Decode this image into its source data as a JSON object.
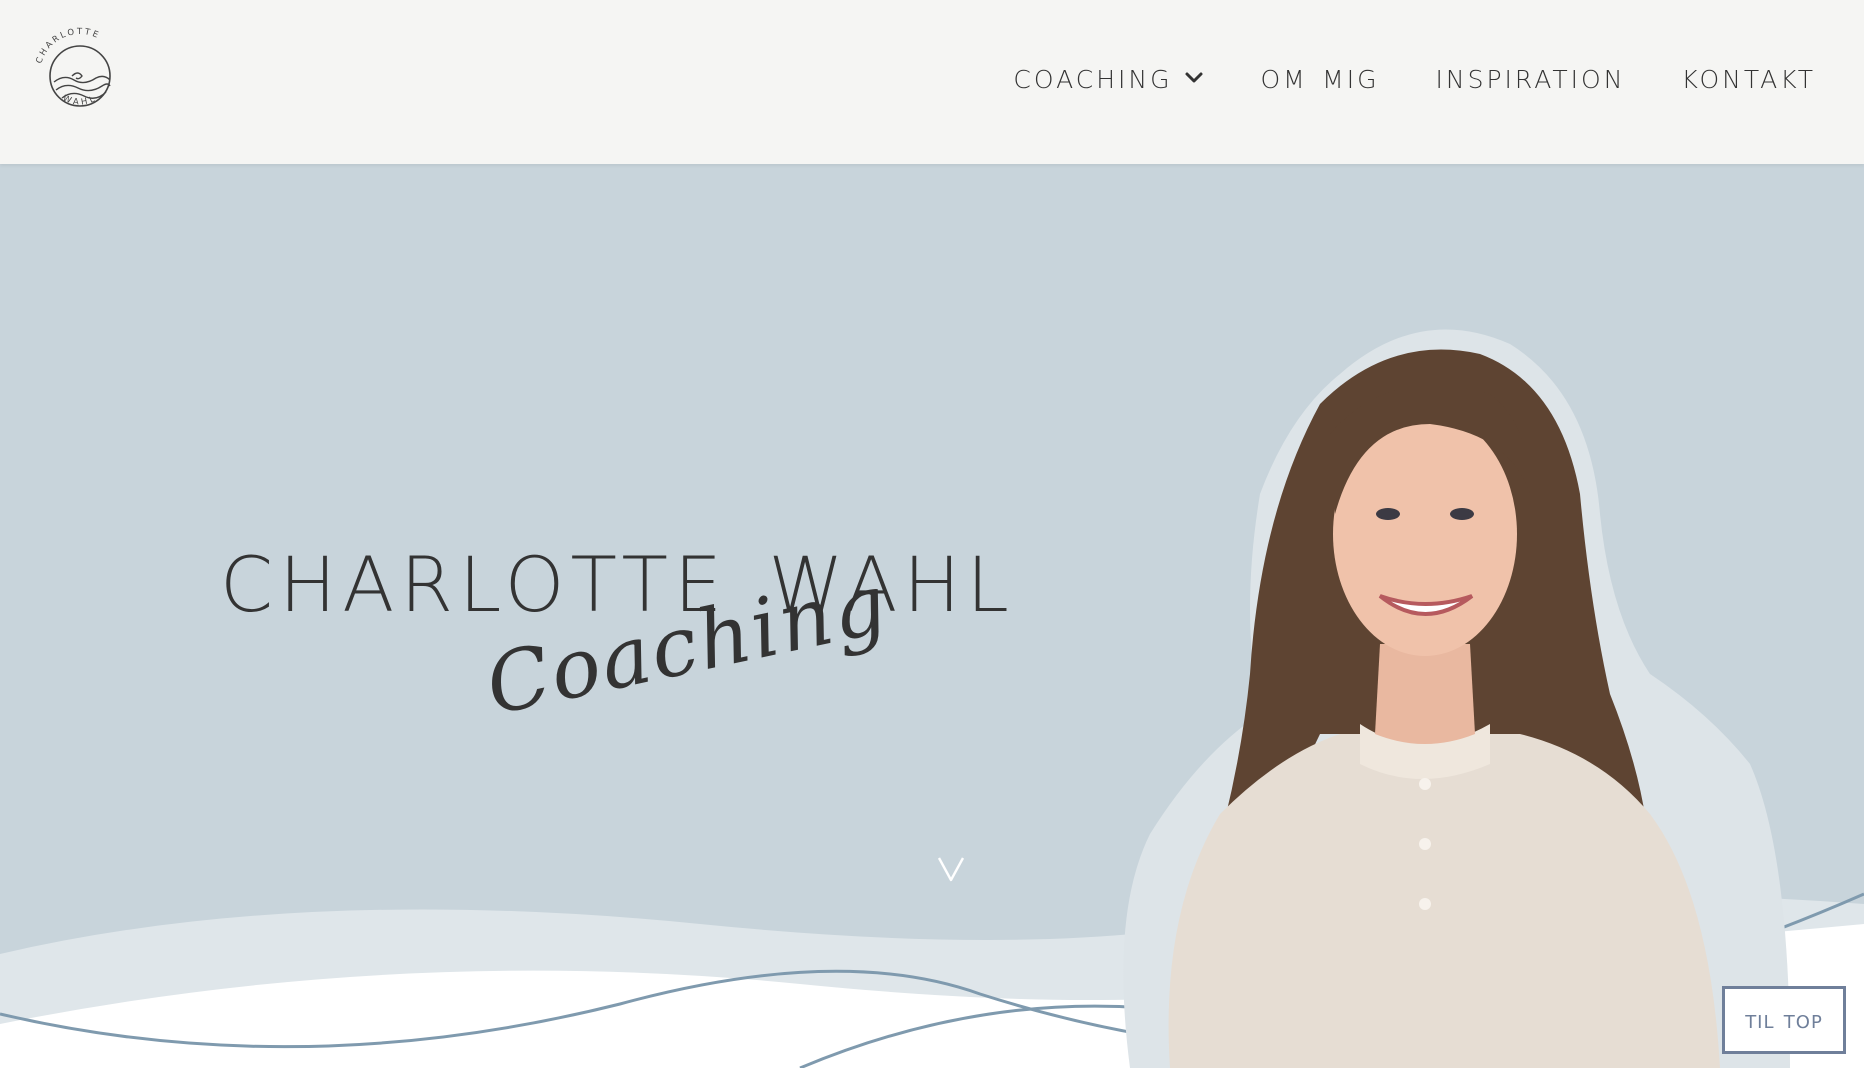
{
  "header": {
    "logo_text_top": "CHARLOTTE",
    "logo_text_bottom": "WAHL",
    "nav": [
      {
        "label": "Coaching",
        "has_dropdown": true
      },
      {
        "label": "Om mig",
        "has_dropdown": false
      },
      {
        "label": "Inspiration",
        "has_dropdown": false
      },
      {
        "label": "Kontakt",
        "has_dropdown": false
      }
    ]
  },
  "hero": {
    "title": "Charlotte Wahl",
    "script": "Coaching",
    "scroll_indicator": "V"
  },
  "til_top": "Til top",
  "colors": {
    "header_bg": "#f5f5f3",
    "hero_bg": "#c8d4db",
    "text": "#333333",
    "wave_line": "#7f9aae",
    "button_border": "#6f7f9a"
  },
  "icons": {
    "logo": "wave-circle-logo",
    "dropdown": "chevron-down-icon",
    "scroll": "scroll-down-icon"
  }
}
